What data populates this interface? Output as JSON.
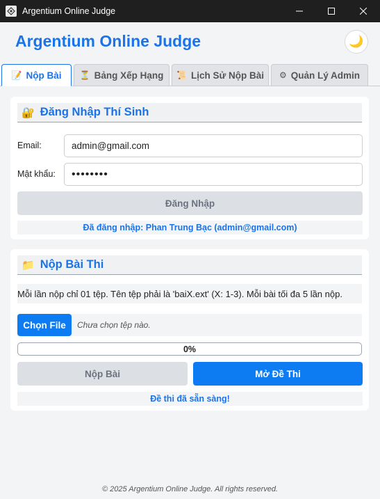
{
  "window": {
    "title": "Argentium Online Judge",
    "minimize_glyph": "—",
    "maximize_glyph": "☐",
    "close_glyph": "✕"
  },
  "header": {
    "title": "Argentium Online Judge",
    "theme_toggle_icon": "🌙"
  },
  "tabs": [
    {
      "label": "Nộp Bài",
      "icon": "📝",
      "active": true
    },
    {
      "label": "Bảng Xếp Hạng",
      "icon": "⏳",
      "active": false
    },
    {
      "label": "Lịch Sử Nộp Bài",
      "icon": "📜",
      "active": false
    },
    {
      "label": "Quản Lý Admin",
      "icon": "⚙",
      "active": false
    }
  ],
  "login": {
    "section_icon": "🔐",
    "section_title": "Đăng Nhập Thí Sinh",
    "email_label": "Email:",
    "email_value": "admin@gmail.com",
    "password_label": "Mật khẩu:",
    "password_value": "••••••••",
    "login_button": "Đăng Nhập",
    "status_text": "Đã đăng nhập: Phan Trung Bạc (admin@gmail.com)"
  },
  "submit": {
    "section_icon": "📁",
    "section_title": "Nộp Bài Thi",
    "note": "Mỗi lần nộp chỉ 01 tệp. Tên tệp phải là 'baiX.ext' (X: 1-3). Mỗi bài tối đa 5 lần nộp.",
    "choose_file_button": "Chọn File",
    "file_status": "Chưa chọn tệp nào.",
    "progress_value": 0,
    "progress_text": "0%",
    "submit_button": "Nộp Bài",
    "open_exam_button": "Mở Đề Thi",
    "status_text": "Đề thi đã sẵn sàng!"
  },
  "footer": {
    "text": "© 2025 Argentium Online Judge. All rights reserved."
  },
  "colors": {
    "accent": "#1a73e8",
    "button_blue": "#0d7cf2",
    "button_disabled": "#dcdfe3",
    "titlebar": "#1f1f1f"
  }
}
